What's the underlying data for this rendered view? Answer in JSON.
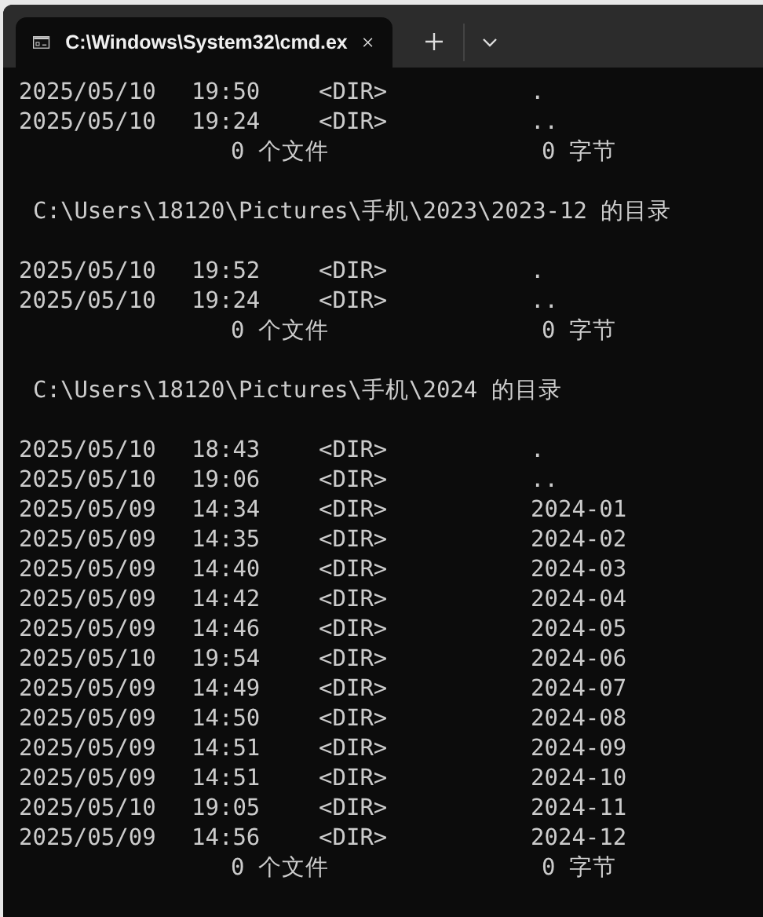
{
  "tab": {
    "title": "C:\\Windows\\System32\\cmd.ex",
    "selected": true
  },
  "lines": [
    {
      "kind": "entry",
      "date": "2025/05/10",
      "time": "19:50",
      "type": "<DIR>",
      "name": "."
    },
    {
      "kind": "entry",
      "date": "2025/05/10",
      "time": "19:24",
      "type": "<DIR>",
      "name": ".."
    },
    {
      "kind": "summary",
      "files": "0 个文件",
      "bytes": "0 字节"
    },
    {
      "kind": "blank"
    },
    {
      "kind": "header",
      "text": "C:\\Users\\18120\\Pictures\\手机\\2023\\2023-12 的目录"
    },
    {
      "kind": "blank"
    },
    {
      "kind": "entry",
      "date": "2025/05/10",
      "time": "19:52",
      "type": "<DIR>",
      "name": "."
    },
    {
      "kind": "entry",
      "date": "2025/05/10",
      "time": "19:24",
      "type": "<DIR>",
      "name": ".."
    },
    {
      "kind": "summary",
      "files": "0 个文件",
      "bytes": "0 字节"
    },
    {
      "kind": "blank"
    },
    {
      "kind": "header",
      "text": "C:\\Users\\18120\\Pictures\\手机\\2024 的目录"
    },
    {
      "kind": "blank"
    },
    {
      "kind": "entry",
      "date": "2025/05/10",
      "time": "18:43",
      "type": "<DIR>",
      "name": "."
    },
    {
      "kind": "entry",
      "date": "2025/05/10",
      "time": "19:06",
      "type": "<DIR>",
      "name": ".."
    },
    {
      "kind": "entry",
      "date": "2025/05/09",
      "time": "14:34",
      "type": "<DIR>",
      "name": "2024-01"
    },
    {
      "kind": "entry",
      "date": "2025/05/09",
      "time": "14:35",
      "type": "<DIR>",
      "name": "2024-02"
    },
    {
      "kind": "entry",
      "date": "2025/05/09",
      "time": "14:40",
      "type": "<DIR>",
      "name": "2024-03"
    },
    {
      "kind": "entry",
      "date": "2025/05/09",
      "time": "14:42",
      "type": "<DIR>",
      "name": "2024-04"
    },
    {
      "kind": "entry",
      "date": "2025/05/09",
      "time": "14:46",
      "type": "<DIR>",
      "name": "2024-05"
    },
    {
      "kind": "entry",
      "date": "2025/05/10",
      "time": "19:54",
      "type": "<DIR>",
      "name": "2024-06"
    },
    {
      "kind": "entry",
      "date": "2025/05/09",
      "time": "14:49",
      "type": "<DIR>",
      "name": "2024-07"
    },
    {
      "kind": "entry",
      "date": "2025/05/09",
      "time": "14:50",
      "type": "<DIR>",
      "name": "2024-08"
    },
    {
      "kind": "entry",
      "date": "2025/05/09",
      "time": "14:51",
      "type": "<DIR>",
      "name": "2024-09"
    },
    {
      "kind": "entry",
      "date": "2025/05/09",
      "time": "14:51",
      "type": "<DIR>",
      "name": "2024-10"
    },
    {
      "kind": "entry",
      "date": "2025/05/10",
      "time": "19:05",
      "type": "<DIR>",
      "name": "2024-11"
    },
    {
      "kind": "entry",
      "date": "2025/05/09",
      "time": "14:56",
      "type": "<DIR>",
      "name": "2024-12"
    },
    {
      "kind": "summary",
      "files": "0 个文件",
      "bytes": "0 字节"
    }
  ]
}
